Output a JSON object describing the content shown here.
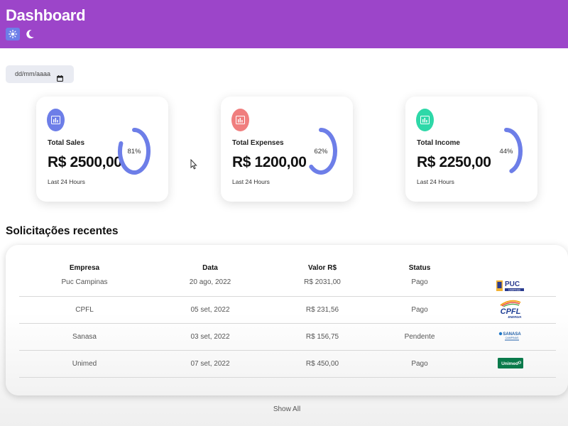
{
  "header": {
    "title": "Dashboard",
    "bg_color": "#9c45c9",
    "theme_icons": [
      "sun-icon",
      "moon-icon"
    ]
  },
  "date_filter": {
    "placeholder": "dd/mm/aaaa",
    "icon": "calendar-icon"
  },
  "cards": [
    {
      "title": "Total Sales",
      "value": "R$ 2500,00",
      "subtitle": "Last 24 Hours",
      "percent_label": "81%",
      "percent": 81,
      "icon_color": "#6d7ee8",
      "icon": "chart-icon"
    },
    {
      "title": "Total Expenses",
      "value": "R$ 1200,00",
      "subtitle": "Last 24 Hours",
      "percent_label": "62%",
      "percent": 62,
      "icon_color": "#f07e7e",
      "icon": "chart-icon"
    },
    {
      "title": "Total Income",
      "value": "R$ 2250,00",
      "subtitle": "Last 24 Hours",
      "percent_label": "44%",
      "percent": 44,
      "icon_color": "#2ed8a8",
      "icon": "chart-icon"
    }
  ],
  "ring_color": "#6d7ee8",
  "recent": {
    "title": "Solicitações recentes",
    "columns": [
      "Empresa",
      "Data",
      "Valor R$",
      "Status"
    ],
    "rows": [
      {
        "empresa": "Puc Campinas",
        "data": "20 ago, 2022",
        "valor": "R$ 2031,00",
        "status": "Pago",
        "logo_text": "PUC",
        "logo_sub": "CAMPINAS"
      },
      {
        "empresa": "CPFL",
        "data": "05 set, 2022",
        "valor": "R$ 231,56",
        "status": "Pago",
        "logo_text": "CPFL",
        "logo_sub": "ENERGIA"
      },
      {
        "empresa": "Sanasa",
        "data": "03 set, 2022",
        "valor": "R$ 156,75",
        "status": "Pendente",
        "logo_text": "SANASA",
        "logo_sub": "CAMPINAS"
      },
      {
        "empresa": "Unimed",
        "data": "07 set, 2022",
        "valor": "R$ 450,00",
        "status": "Pago",
        "logo_text": "Unimed"
      }
    ],
    "show_all": "Show All"
  }
}
